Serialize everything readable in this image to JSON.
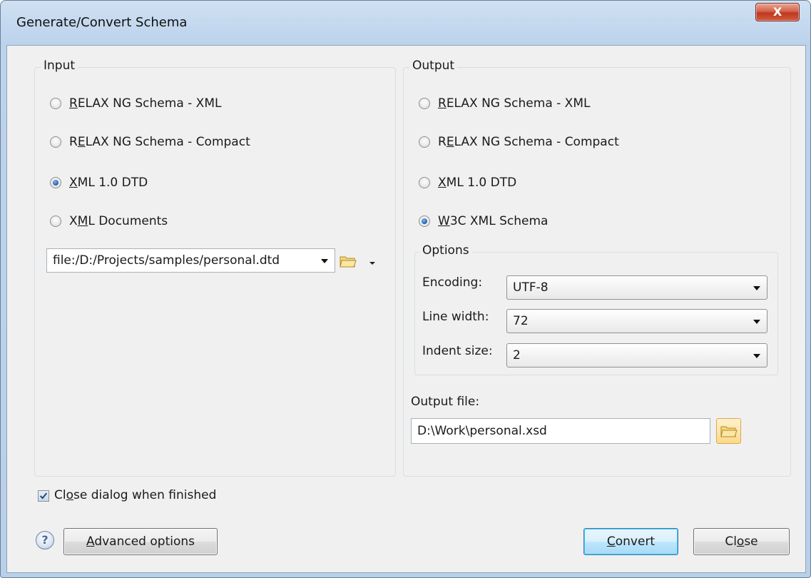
{
  "window": {
    "title": "Generate/Convert Schema",
    "close_glyph": "X"
  },
  "input": {
    "title": "Input",
    "options": [
      {
        "pre": "",
        "key": "R",
        "post": "ELAX NG Schema - XML",
        "checked": false
      },
      {
        "pre": "R",
        "key": "E",
        "post": "LAX NG Schema - Compact",
        "checked": false
      },
      {
        "pre": "",
        "key": "X",
        "post": "ML 1.0 DTD",
        "checked": true
      },
      {
        "pre": "X",
        "key": "M",
        "post": "L Documents",
        "checked": false
      }
    ],
    "file_value": "file:/D:/Projects/samples/personal.dtd"
  },
  "output": {
    "title": "Output",
    "options": [
      {
        "pre": "",
        "key": "R",
        "post": "ELAX NG Schema - XML",
        "checked": false
      },
      {
        "pre": "R",
        "key": "E",
        "post": "LAX NG Schema - Compact",
        "checked": false
      },
      {
        "pre": "",
        "key": "X",
        "post": "ML 1.0 DTD",
        "checked": false
      },
      {
        "pre": "",
        "key": "W",
        "post": "3C XML Schema",
        "checked": true
      }
    ],
    "options_group": {
      "title": "Options",
      "encoding_label": "Encoding:",
      "encoding_value": "UTF-8",
      "line_width_label": "Line width:",
      "line_width_value": "72",
      "indent_label": "Indent size:",
      "indent_value": "2"
    },
    "output_file_label": "Output file:",
    "output_file_value": "D:\\Work\\personal.xsd"
  },
  "close_when_finished": {
    "pre": "Cl",
    "key": "o",
    "post": "se dialog when finished",
    "checked": true
  },
  "buttons": {
    "help_glyph": "?",
    "advanced": {
      "pre": "",
      "key": "A",
      "post": "dvanced options"
    },
    "convert": {
      "pre": "",
      "key": "C",
      "post": "onvert"
    },
    "close": {
      "pre": "Cl",
      "key": "o",
      "post": "se"
    }
  },
  "colors": {
    "accent": "#3c7fb1",
    "close_red": "#c1381f",
    "folder_yellow": "#f3c64a"
  }
}
